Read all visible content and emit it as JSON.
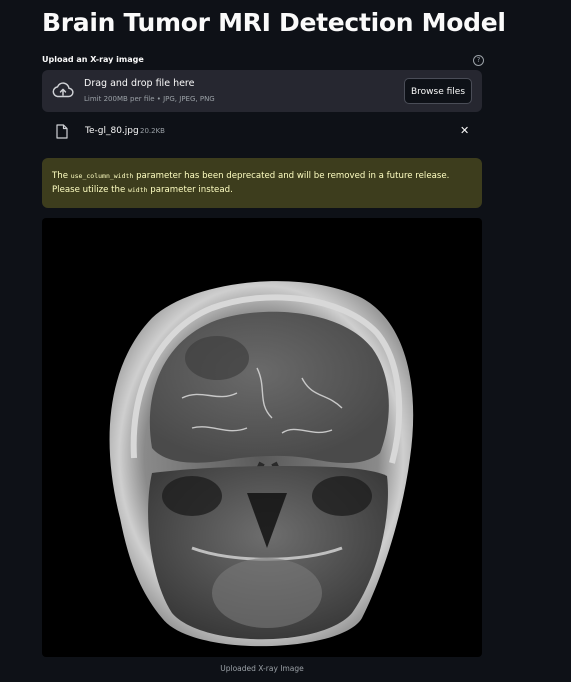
{
  "header": {
    "title": "Brain Tumor MRI Detection Model"
  },
  "uploader": {
    "label": "Upload an X-ray image",
    "help_icon": "question-circle-icon",
    "help_glyph": "?",
    "dropzone": {
      "icon": "cloud-upload-icon",
      "title": "Drag and drop file here",
      "subtitle": "Limit 200MB per file • JPG, JPEG, PNG",
      "browse_label": "Browse files"
    },
    "file": {
      "icon": "file-icon",
      "name": "Te-gl_80.jpg",
      "size": "20.2KB",
      "remove_glyph": "✕"
    }
  },
  "warning": {
    "part1": "The ",
    "code1": "use_column_width",
    "part2": " parameter has been deprecated and will be removed in a future release. Please utilize the ",
    "code2": "width",
    "part3": " parameter instead.",
    "bg_color": "#3d3d1d",
    "text_color": "#ffffc2"
  },
  "image": {
    "caption": "Uploaded X-ray Image"
  },
  "colors": {
    "background": "#0e1117",
    "surface": "#262730",
    "text": "#fafafa",
    "muted": "#9aa0a6"
  }
}
